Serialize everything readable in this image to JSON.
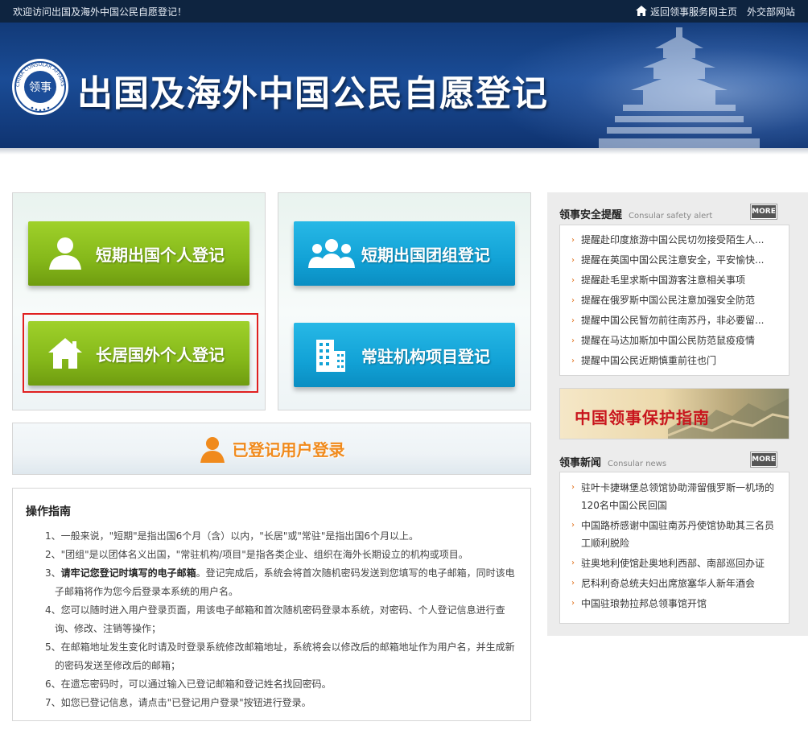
{
  "topbar": {
    "welcome": "欢迎访问出国及海外中国公民自愿登记！",
    "home_link": "返回领事服务网主页",
    "mfa_link": "外交部网站"
  },
  "banner": {
    "title": "出国及海外中国公民自愿登记",
    "emblem_text": "CHINA CONSULAR AFFAIRS"
  },
  "buttons": {
    "short_personal": "短期出国个人登记",
    "short_group": "短期出国团组登记",
    "long_personal": "长居国外个人登记",
    "institution": "常驻机构项目登记"
  },
  "login": {
    "label": "已登记用户登录"
  },
  "guide": {
    "title": "操作指南",
    "items": [
      "1、一般来说，\"短期\"是指出国6个月（含）以内，\"长居\"或\"常驻\"是指出国6个月以上。",
      "2、\"团组\"是以团体名义出国，\"常驻机构/项目\"是指各类企业、组织在海外长期设立的机构或项目。",
      "4、您可以随时进入用户登录页面，用该电子邮箱和首次随机密码登录本系统，对密码、个人登记信息进行查询、修改、注销等操作；",
      "5、在邮箱地址发生变化时请及时登录系统修改邮箱地址，系统将会以修改后的邮箱地址作为用户名，并生成新的密码发送至修改后的邮箱；",
      "6、在遗忘密码时，可以通过输入已登记邮箱和登记姓名找回密码。",
      "7、如您已登记信息，请点击\"已登记用户登录\"按钮进行登录。"
    ],
    "item3_prefix": "3、",
    "item3_bold": "请牢记您登记时填写的电子邮箱",
    "item3_rest": "。登记完成后，系统会将首次随机密码发送到您填写的电子邮箱，同时该电子邮箱将作为您今后登录本系统的用户名。"
  },
  "safety": {
    "title": "领事安全提醒",
    "subtitle": "Consular safety alert",
    "more": "MORE",
    "items": [
      "提醒赴印度旅游中国公民切勿接受陌生人...",
      "提醒在英国中国公民注意安全，平安愉快...",
      "提醒赴毛里求斯中国游客注意相关事项",
      "提醒在俄罗斯中国公民注意加强安全防范",
      "提醒中国公民暂勿前往南苏丹，非必要留...",
      "提醒在马达加斯加中国公民防范鼠疫疫情",
      "提醒中国公民近期慎重前往也门"
    ]
  },
  "promo": {
    "text": "中国领事保护指南"
  },
  "news": {
    "title": "领事新闻",
    "subtitle": "Consular news",
    "more": "MORE",
    "items": [
      "驻叶卡捷琳堡总领馆协助滞留俄罗斯一机场的120名中国公民回国",
      "中国路桥感谢中国驻南苏丹使馆协助其三名员工顺利脱险",
      "驻奥地利使馆赴奥地利西部、南部巡回办证",
      "尼科利奇总统夫妇出席旅塞华人新年酒会",
      "中国驻琅勃拉邦总领事馆开馆"
    ]
  },
  "colors": {
    "topbar": "#0e2440",
    "banner": "#1a4c96",
    "green": "#85b81a",
    "blue": "#12a2d6",
    "highlight": "#e02020",
    "accent": "#f08a1c"
  }
}
